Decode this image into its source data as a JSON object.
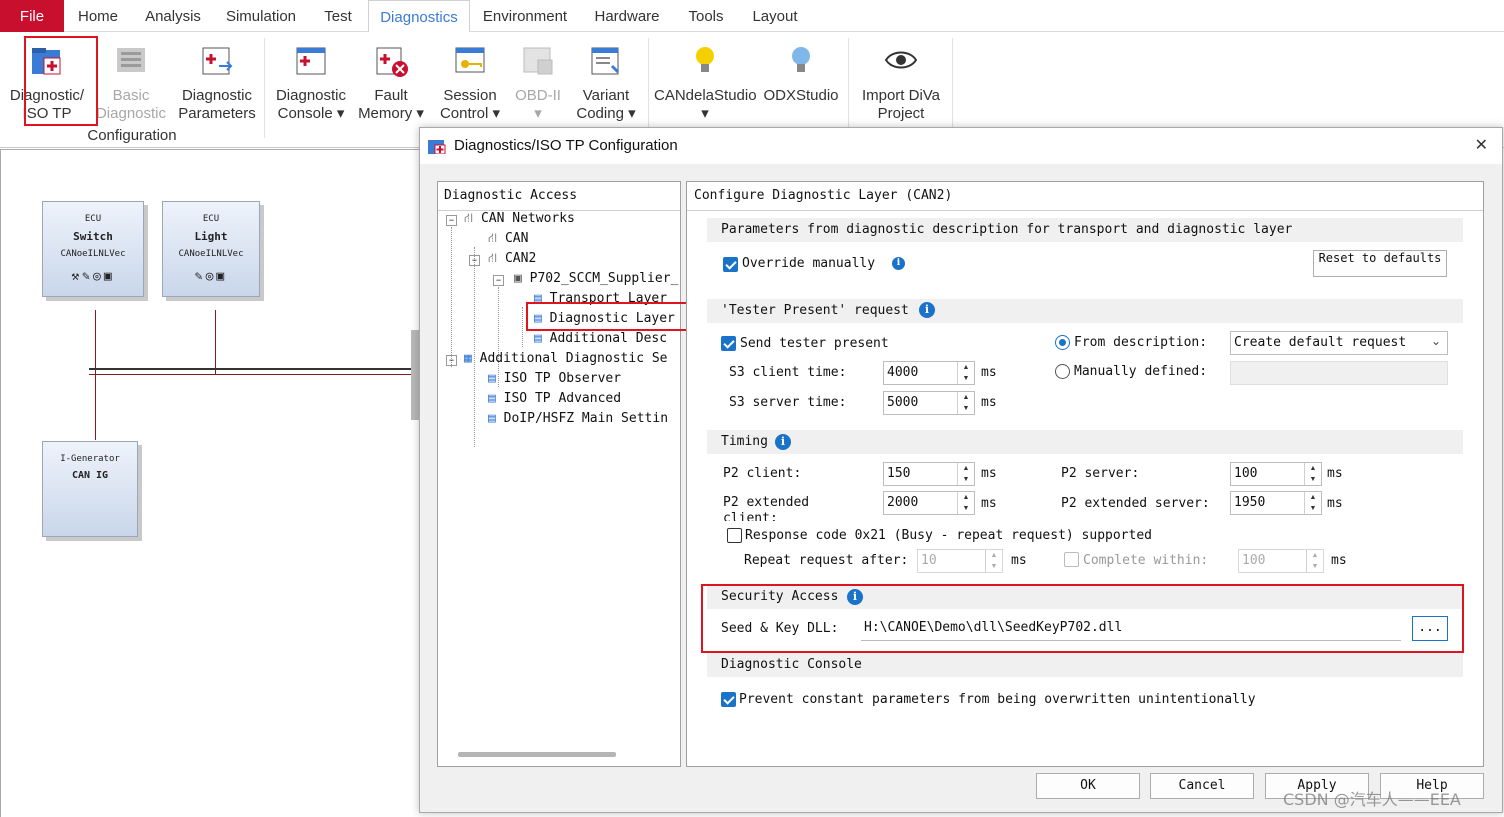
{
  "tabs": [
    "File",
    "Home",
    "Analysis",
    "Simulation",
    "Test",
    "Diagnostics",
    "Environment",
    "Hardware",
    "Tools",
    "Layout"
  ],
  "ribbon": {
    "buttons": [
      {
        "line1": "Diagnostic/",
        "line2": "ISO TP"
      },
      {
        "line1": "Basic",
        "line2": "Diagnostic"
      },
      {
        "line1": "Diagnostic",
        "line2": "Parameters"
      },
      {
        "line1": "Diagnostic",
        "line2": "Console ▾"
      },
      {
        "line1": "Fault",
        "line2": "Memory ▾"
      },
      {
        "line1": "Session",
        "line2": "Control ▾"
      },
      {
        "line1": "OBD-II",
        "line2": "▾"
      },
      {
        "line1": "Variant",
        "line2": "Coding ▾"
      },
      {
        "line1": "CANdelaStudio",
        "line2": "▾"
      },
      {
        "line1": "ODXStudio",
        "line2": ""
      },
      {
        "line1": "Import DiVa",
        "line2": "Project"
      }
    ],
    "group_label": "Configuration"
  },
  "canvas": {
    "ecu_switch": {
      "type": "ECU",
      "name": "Switch",
      "sub": "CANoeILNLVec"
    },
    "ecu_light": {
      "type": "ECU",
      "name": "Light",
      "sub": "CANoeILNLVec"
    },
    "generator": {
      "type": "I-Generator",
      "name": "CAN IG"
    }
  },
  "dialog": {
    "title": "Diagnostics/ISO TP Configuration",
    "close": "✕",
    "left_header": "Diagnostic Access",
    "tree": [
      "CAN Networks",
      "CAN",
      "CAN2",
      "P702_SCCM_Supplier_",
      "Transport Layer",
      "Diagnostic Layer",
      "Additional Desc",
      "Additional Diagnostic Se",
      "ISO TP Observer",
      "ISO TP Advanced",
      "DoIP/HSFZ Main Settin"
    ],
    "right_header": "Configure Diagnostic Layer (CAN2)",
    "params_group": "Parameters from diagnostic description for transport and diagnostic layer",
    "override_label": "Override manually",
    "reset_label": "Reset to defaults",
    "tester_group": "'Tester Present' request",
    "send_tester_label": "Send tester present",
    "from_desc_label": "From description:",
    "from_desc_value": "Create default request",
    "manual_def_label": "Manually defined:",
    "s3_client_label": "S3 client time:",
    "s3_client_value": "4000",
    "s3_server_label": "S3 server time:",
    "s3_server_value": "5000",
    "ms": "ms",
    "timing_group": "Timing",
    "p2_client_label": "P2 client:",
    "p2_client_value": "150",
    "p2_server_label": "P2 server:",
    "p2_server_value": "100",
    "p2_ext_label": "P2 extended client:",
    "p2_ext_value": "2000",
    "p2_ext_server_label": "P2 extended server:",
    "p2_ext_server_value": "1950",
    "resp_code_label": "Response code 0x21 (Busy - repeat request) supported",
    "repeat_label": "Repeat request after:",
    "repeat_value": "10",
    "complete_label": "Complete within:",
    "complete_value": "100",
    "security_group": "Security Access",
    "seed_key_label": "Seed & Key DLL:",
    "seed_key_value": "H:\\CANOE\\Demo\\dll\\SeedKeyP702.dll",
    "browse_label": "...",
    "console_group": "Diagnostic Console",
    "prevent_label": "Prevent constant parameters from being overwritten unintentionally",
    "buttons": {
      "ok": "OK",
      "cancel": "Cancel",
      "apply": "Apply",
      "help": "Help"
    }
  },
  "watermark": "CSDN @汽车人——EEA",
  "colors": {
    "file_tab": "#c8102e",
    "accent": "#1a73c9",
    "highlight": "#e0141e"
  }
}
